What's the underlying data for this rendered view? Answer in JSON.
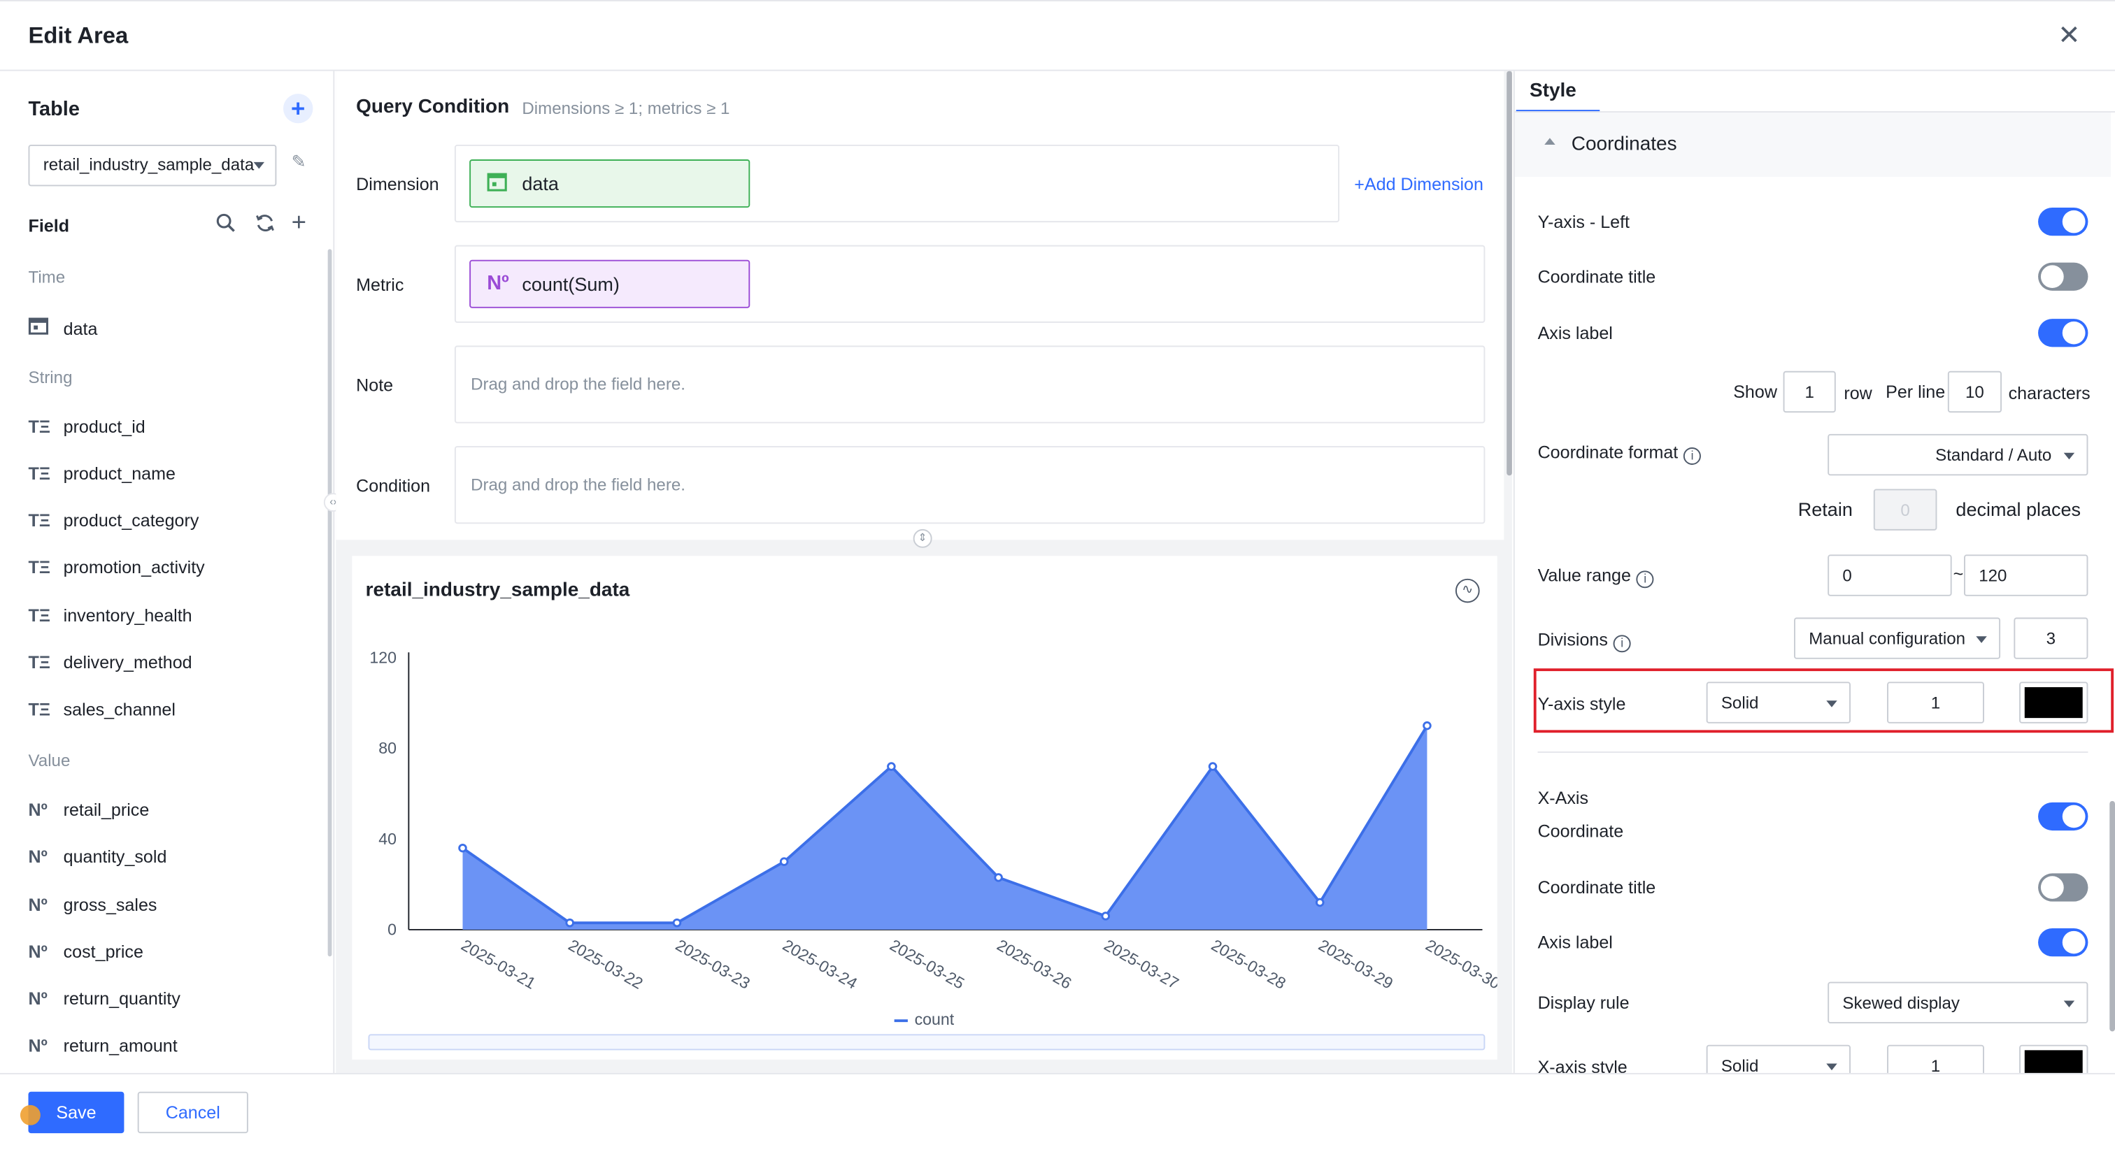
{
  "dialog": {
    "title": "Edit Area",
    "close_glyph": "✕"
  },
  "left_panel": {
    "table_title": "Table",
    "table_select_value": "retail_industry_sample_data",
    "field_title": "Field",
    "groups": {
      "time": "Time",
      "string": "String",
      "value": "Value"
    },
    "time_fields": [
      "data"
    ],
    "string_fields": [
      "product_id",
      "product_name",
      "product_category",
      "promotion_activity",
      "inventory_health",
      "delivery_method",
      "sales_channel"
    ],
    "value_fields": [
      "retail_price",
      "quantity_sold",
      "gross_sales",
      "cost_price",
      "return_quantity",
      "return_amount"
    ],
    "string_icon": "TΞ",
    "value_icon": "Nº"
  },
  "query": {
    "title": "Query Condition",
    "subtitle": "Dimensions ≥ 1; metrics ≥ 1",
    "dimension_label": "Dimension",
    "dimension_chip": "data",
    "add_dimension": "Add Dimension",
    "metric_label": "Metric",
    "metric_chip": "count(Sum)",
    "note_label": "Note",
    "condition_label": "Condition",
    "drop_placeholder": "Drag and drop the field here."
  },
  "chart_card": {
    "title": "retail_industry_sample_data"
  },
  "chart_data": {
    "type": "area",
    "title": "retail_industry_sample_data",
    "categories": [
      "2025-03-21",
      "2025-03-22",
      "2025-03-23",
      "2025-03-24",
      "2025-03-25",
      "2025-03-26",
      "2025-03-27",
      "2025-03-28",
      "2025-03-29",
      "2025-03-30"
    ],
    "series": [
      {
        "name": "count",
        "values": [
          36,
          3,
          3,
          30,
          72,
          23,
          6,
          72,
          12,
          90
        ],
        "color": "#3c6fe8"
      }
    ],
    "y_ticks": [
      "0",
      "40",
      "80",
      "120"
    ],
    "ylim": [
      0,
      120
    ],
    "legend": "bottom-center",
    "grid": false
  },
  "style_panel": {
    "tab": "Style",
    "section": "Coordinates",
    "y_axis_left": "Y-axis - Left",
    "coordinate_title": "Coordinate title",
    "axis_label": "Axis label",
    "show": "Show",
    "show_rows": "1",
    "row": "row",
    "per_line": "Per line",
    "per_line_chars": "10",
    "characters": "characters",
    "coordinate_format": "Coordinate format",
    "coordinate_format_value": "Standard / Auto",
    "retain": "Retain",
    "retain_value": "0",
    "decimal_places": "decimal places",
    "value_range": "Value range",
    "range_min": "0",
    "range_sep": "~",
    "range_max": "120",
    "divisions": "Divisions",
    "divisions_mode": "Manual configuration",
    "divisions_count": "3",
    "y_axis_style": "Y-axis style",
    "y_line_style": "Solid",
    "y_line_width": "1",
    "y_line_color": "#000000",
    "x_axis_line1": "X-Axis",
    "x_axis_line2": "Coordinate",
    "x_coordinate_title": "Coordinate title",
    "x_axis_label": "Axis label",
    "display_rule": "Display rule",
    "display_rule_value": "Skewed display",
    "x_axis_style": "X-axis style",
    "x_line_style": "Solid",
    "x_line_width": "1",
    "x_line_color": "#000000",
    "toggles": {
      "y_axis_left": true,
      "coordinate_title": false,
      "axis_label": true,
      "x_axis": true,
      "x_coordinate_title": false,
      "x_axis_label": true
    }
  },
  "footer": {
    "save": "Save",
    "cancel": "Cancel"
  }
}
